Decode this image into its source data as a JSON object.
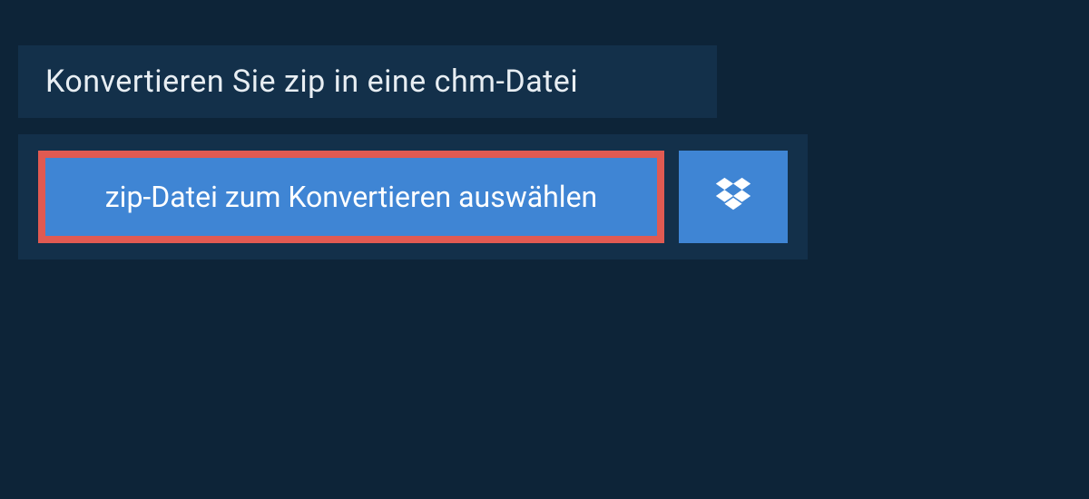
{
  "header": {
    "title": "Konvertieren Sie zip in eine chm-Datei"
  },
  "upload": {
    "select_label": "zip-Datei zum Konvertieren auswählen",
    "dropbox_icon": "dropbox-icon"
  },
  "colors": {
    "background": "#0d2438",
    "panel": "#13304a",
    "button": "#3f85d4",
    "highlight_border": "#e05a52",
    "text_light": "#e8eef3"
  }
}
